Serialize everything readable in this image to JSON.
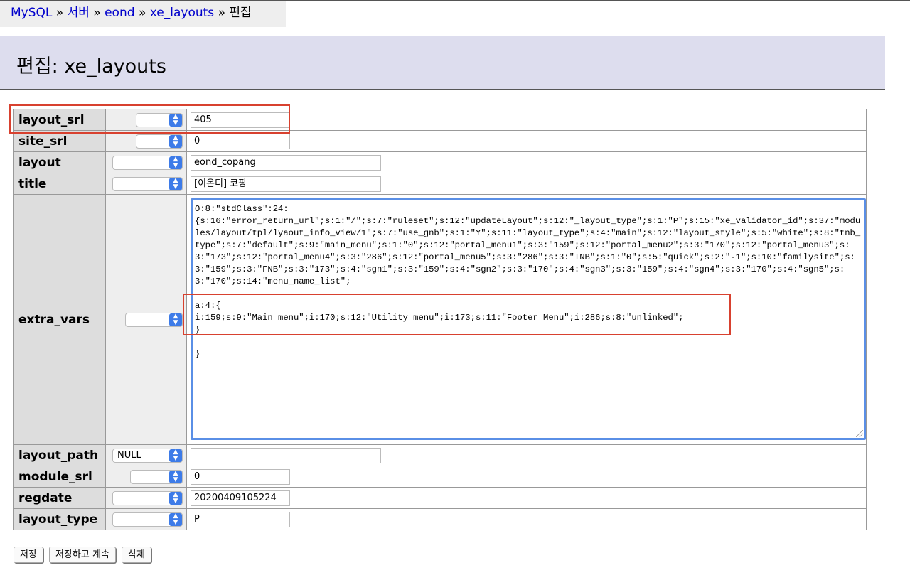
{
  "breadcrumb": {
    "items": [
      "MySQL",
      "서버",
      "eond",
      "xe_layouts",
      "편집"
    ],
    "separator": "»"
  },
  "page_title": "편집: xe_layouts",
  "fields": [
    {
      "name": "layout_srl",
      "func": "",
      "value": "405"
    },
    {
      "name": "site_srl",
      "func": "",
      "value": "0"
    },
    {
      "name": "layout",
      "func": "",
      "value": "eond_copang"
    },
    {
      "name": "title",
      "func": "",
      "value": "[이온디] 코팡"
    },
    {
      "name": "extra_vars",
      "func": "",
      "value": ""
    },
    {
      "name": "layout_path",
      "func": "NULL",
      "value": ""
    },
    {
      "name": "module_srl",
      "func": "",
      "value": "0"
    },
    {
      "name": "regdate",
      "func": "",
      "value": "20200409105224"
    },
    {
      "name": "layout_type",
      "func": "",
      "value": "P"
    }
  ],
  "extra_vars_text": "O:8:\"stdClass\":24:\n{s:16:\"error_return_url\";s:1:\"/\";s:7:\"ruleset\";s:12:\"updateLayout\";s:12:\"_layout_type\";s:1:\"P\";s:15:\"xe_validator_id\";s:37:\"modules/layout/tpl/lyaout_info_view/1\";s:7:\"use_gnb\";s:1:\"Y\";s:11:\"layout_type\";s:4:\"main\";s:12:\"layout_style\";s:5:\"white\";s:8:\"tnb_type\";s:7:\"default\";s:9:\"main_menu\";s:1:\"0\";s:12:\"portal_menu1\";s:3:\"159\";s:12:\"portal_menu2\";s:3:\"170\";s:12:\"portal_menu3\";s:3:\"173\";s:12:\"portal_menu4\";s:3:\"286\";s:12:\"portal_menu5\";s:3:\"286\";s:3:\"TNB\";s:1:\"0\";s:5:\"quick\";s:2:\"-1\";s:10:\"familysite\";s:3:\"159\";s:3:\"FNB\";s:3:\"173\";s:4:\"sgn1\";s:3:\"159\";s:4:\"sgn2\";s:3:\"170\";s:4:\"sgn3\";s:3:\"159\";s:4:\"sgn4\";s:3:\"170\";s:4:\"sgn5\";s:3:\"170\";s:14:\"menu_name_list\";\n\na:4:{\ni:159;s:9:\"Main menu\";i:170;s:12:\"Utility menu\";i:173;s:11:\"Footer Menu\";i:286;s:8:\"unlinked\";\n}\n\n}",
  "buttons": {
    "save": "저장",
    "save_continue": "저장하고 계속",
    "delete": "삭제"
  },
  "colors": {
    "highlight_box": "#d8412f",
    "textarea_focus": "#5a8fe6",
    "header_bg": "#ddddee",
    "select_arrow": "#3d7be8"
  }
}
